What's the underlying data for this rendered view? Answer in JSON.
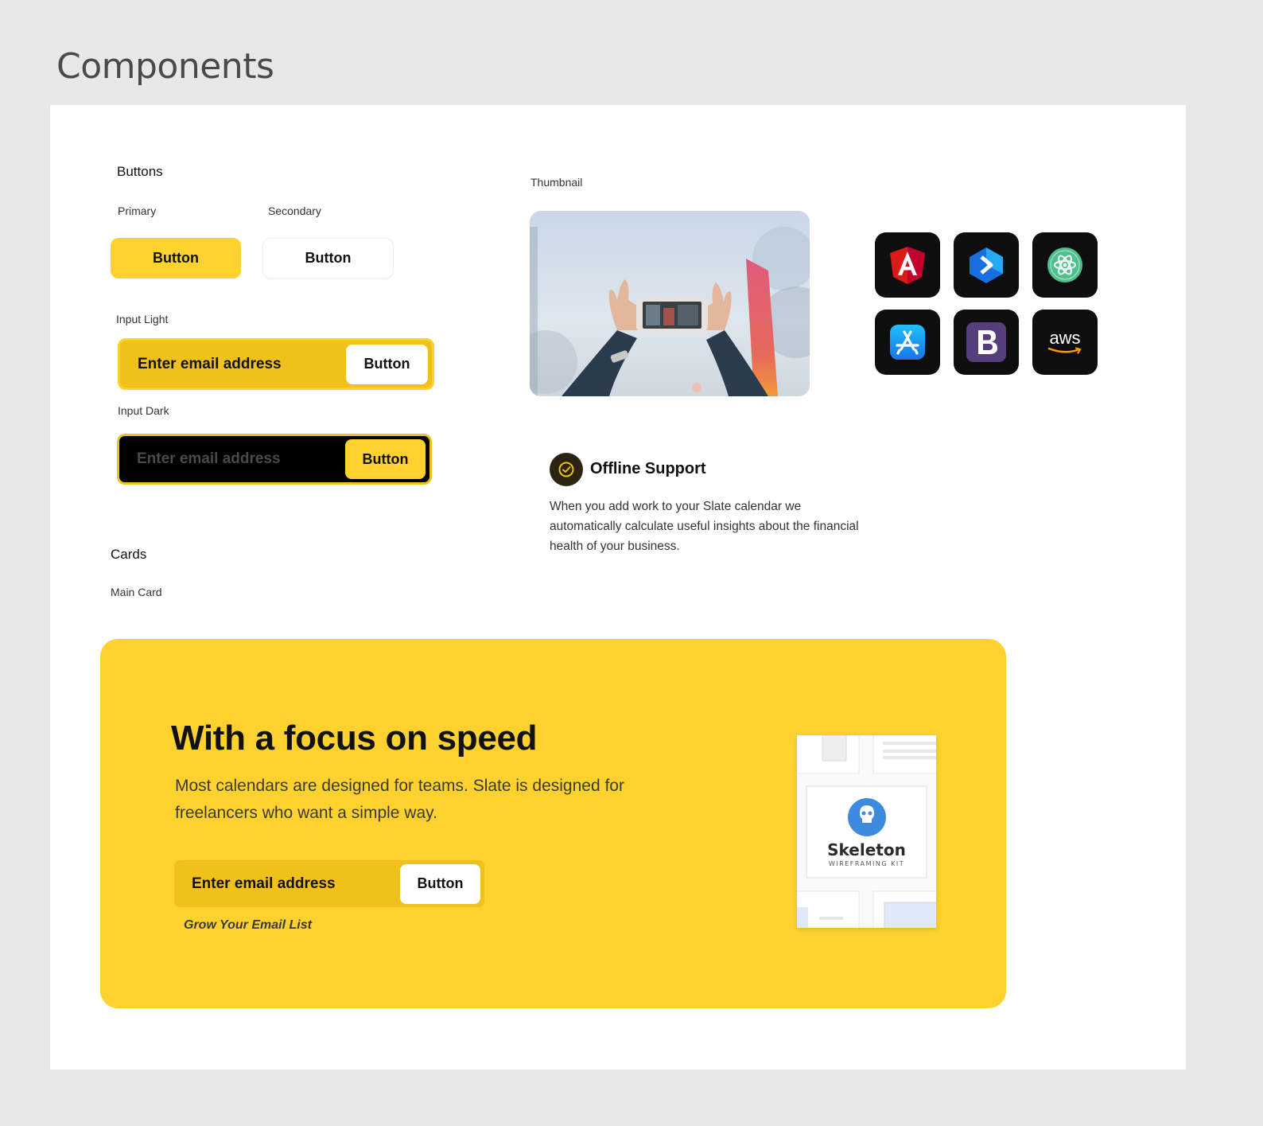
{
  "page": {
    "title": "Components"
  },
  "buttons": {
    "section_label": "Buttons",
    "primary_label": "Primary",
    "secondary_label": "Secondary",
    "primary_button": "Button",
    "secondary_button": "Button"
  },
  "input_light": {
    "label": "Input Light",
    "placeholder": "Enter email address",
    "button": "Button"
  },
  "input_dark": {
    "label": "Input Dark",
    "placeholder": "Enter email address",
    "button": "Button"
  },
  "thumbnail": {
    "label": "Thumbnail"
  },
  "app_icons": [
    {
      "name": "angular-icon"
    },
    {
      "name": "dart-icon"
    },
    {
      "name": "atom-icon"
    },
    {
      "name": "app-store-icon"
    },
    {
      "name": "bootstrap-icon"
    },
    {
      "name": "aws-icon",
      "text": "aws"
    }
  ],
  "feature": {
    "title": "Offline Support",
    "description": "When you add work to your Slate calendar we automatically calculate useful insights about the financial health of your business."
  },
  "cards": {
    "section_label": "Cards",
    "main_card_label": "Main Card"
  },
  "main_card": {
    "heading": "With a focus on speed",
    "description": "Most calendars are designed for teams. Slate is designed for freelancers who want a simple way.",
    "input_placeholder": "Enter email address",
    "button": "Button",
    "caption": "Grow Your Email List",
    "skeleton_title": "Skeleton",
    "skeleton_subtitle": "WIREFRAMING KIT"
  },
  "colors": {
    "background": "#e8e8e8",
    "canvas": "#ffffff",
    "accent_yellow": "#fdd22f",
    "accent_dark_yellow": "#f0c11a",
    "icon_tile": "#0e0e0e"
  }
}
